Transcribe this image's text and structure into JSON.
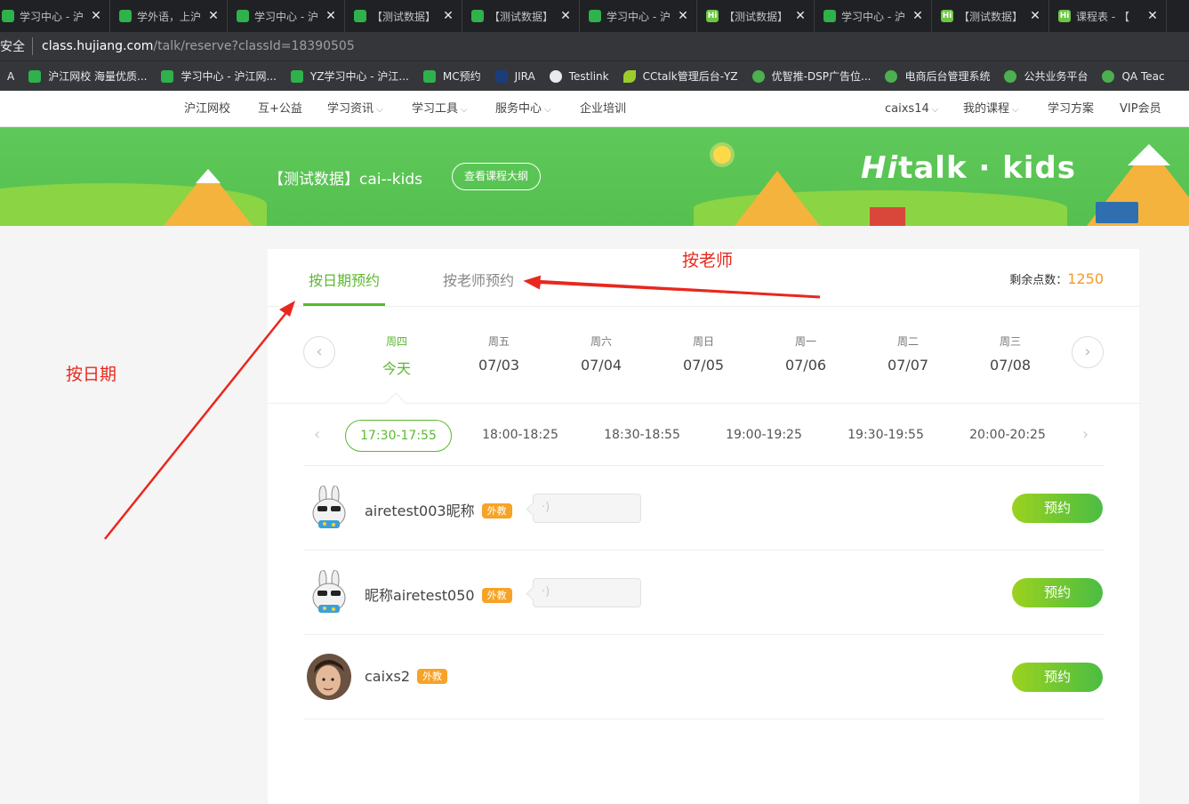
{
  "browser": {
    "tabs": [
      {
        "title": "学习中心 - 沪",
        "favicon": "sprout-icon"
      },
      {
        "title": "学外语，上沪",
        "favicon": "sprout-icon"
      },
      {
        "title": "学习中心 - 沪",
        "favicon": "sprout-icon"
      },
      {
        "title": "【测试数据】",
        "favicon": "sprout-icon"
      },
      {
        "title": "【测试数据】",
        "favicon": "sprout-icon"
      },
      {
        "title": "学习中心 - 沪",
        "favicon": "sprout-icon"
      },
      {
        "title": "【测试数据】",
        "favicon": "hi-icon"
      },
      {
        "title": "学习中心 - 沪",
        "favicon": "sprout-icon"
      },
      {
        "title": "【测试数据】",
        "favicon": "hi-icon"
      },
      {
        "title": "课程表 - 【",
        "favicon": "hi-icon"
      }
    ],
    "security": "安全",
    "url_host": "class.hujiang.com",
    "url_path": "/talk/reserve?classId=18390505",
    "bookmarks": [
      {
        "label": "A",
        "icon": ""
      },
      {
        "label": "沪江网校 海量优质...",
        "icon": "sprout-icon"
      },
      {
        "label": "学习中心 - 沪江网...",
        "icon": "sprout-icon"
      },
      {
        "label": "YZ学习中心 - 沪江...",
        "icon": "sprout-icon"
      },
      {
        "label": "MC预约",
        "icon": "sprout-icon"
      },
      {
        "label": "JIRA",
        "icon": "jira-icon"
      },
      {
        "label": "Testlink",
        "icon": "globe-icon"
      },
      {
        "label": "CCtalk管理后台-YZ",
        "icon": "leaf-icon"
      },
      {
        "label": "优智推-DSP广告位...",
        "icon": "target-icon"
      },
      {
        "label": "电商后台管理系统",
        "icon": "c-icon"
      },
      {
        "label": "公共业务平台",
        "icon": "c-icon"
      },
      {
        "label": "QA Teac",
        "icon": "c-icon"
      }
    ],
    "tab_close": "✕"
  },
  "sitenav": {
    "left": [
      "沪江网校",
      "互+公益",
      "学习资讯",
      "学习工具",
      "服务中心",
      "企业培训"
    ],
    "right": [
      "caixs14",
      "我的课程",
      "学习方案",
      "VIP会员"
    ],
    "caret": "⌵"
  },
  "banner": {
    "course_title": "【测试数据】cai--kids",
    "outline_button": "查看课程大纲",
    "brand_hi": "Hi",
    "brand_rest": "talk · kids",
    "bg_color": "#5ec95a"
  },
  "reserve": {
    "tab_by_date": "按日期预约",
    "tab_by_teacher": "按老师预约",
    "points_label": "剩余点数：",
    "points_value": "1250",
    "prev_arrow": "‹",
    "next_arrow": "›",
    "days": [
      {
        "weekday": "周四",
        "date": "今天"
      },
      {
        "weekday": "周五",
        "date": "07/03"
      },
      {
        "weekday": "周六",
        "date": "07/04"
      },
      {
        "weekday": "周日",
        "date": "07/05"
      },
      {
        "weekday": "周一",
        "date": "07/06"
      },
      {
        "weekday": "周二",
        "date": "07/07"
      },
      {
        "weekday": "周三",
        "date": "07/08"
      }
    ],
    "time_slots": [
      "17:30-17:55",
      "18:00-18:25",
      "18:30-18:55",
      "19:00-19:25",
      "19:30-19:55",
      "20:00-20:25"
    ],
    "teachers": [
      {
        "name": "airetest003昵称",
        "badge": "外教",
        "has_audio": true,
        "book": "预约"
      },
      {
        "name": "昵称airetest050",
        "badge": "外教",
        "has_audio": true,
        "book": "预约"
      },
      {
        "name": "caixs2",
        "badge": "外教",
        "has_audio": false,
        "book": "预约"
      }
    ],
    "accent_color": "#5cb82f",
    "points_color": "#f29a2e"
  },
  "annotations": {
    "by_teacher": "按老师",
    "by_date": "按日期",
    "color": "#e8281e"
  }
}
